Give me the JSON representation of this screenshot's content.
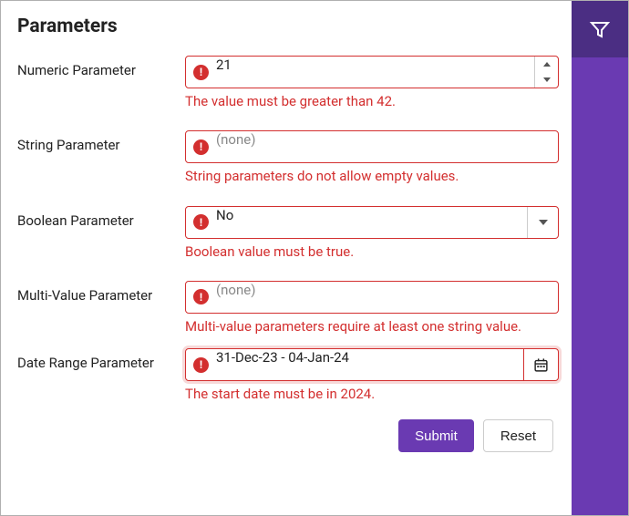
{
  "title": "Parameters",
  "colors": {
    "accent": "#6a3ab2",
    "accent_dark": "#4b2e83",
    "error": "#d32f2f"
  },
  "fields": {
    "numeric": {
      "label": "Numeric Parameter",
      "value": "21",
      "error": "The value must be greater than 42."
    },
    "string": {
      "label": "String Parameter",
      "placeholder": "(none)",
      "value": "",
      "error": "String parameters do not allow empty values."
    },
    "boolean": {
      "label": "Boolean Parameter",
      "value": "No",
      "error": "Boolean value must be true."
    },
    "multi": {
      "label": "Multi-Value Parameter",
      "placeholder": "(none)",
      "value": "",
      "error": "Multi-value parameters require at least one string value."
    },
    "daterange": {
      "label": "Date Range Parameter",
      "value": "31-Dec-23 - 04-Jan-24",
      "error": "The start date must be in 2024."
    }
  },
  "actions": {
    "submit": "Submit",
    "reset": "Reset"
  }
}
